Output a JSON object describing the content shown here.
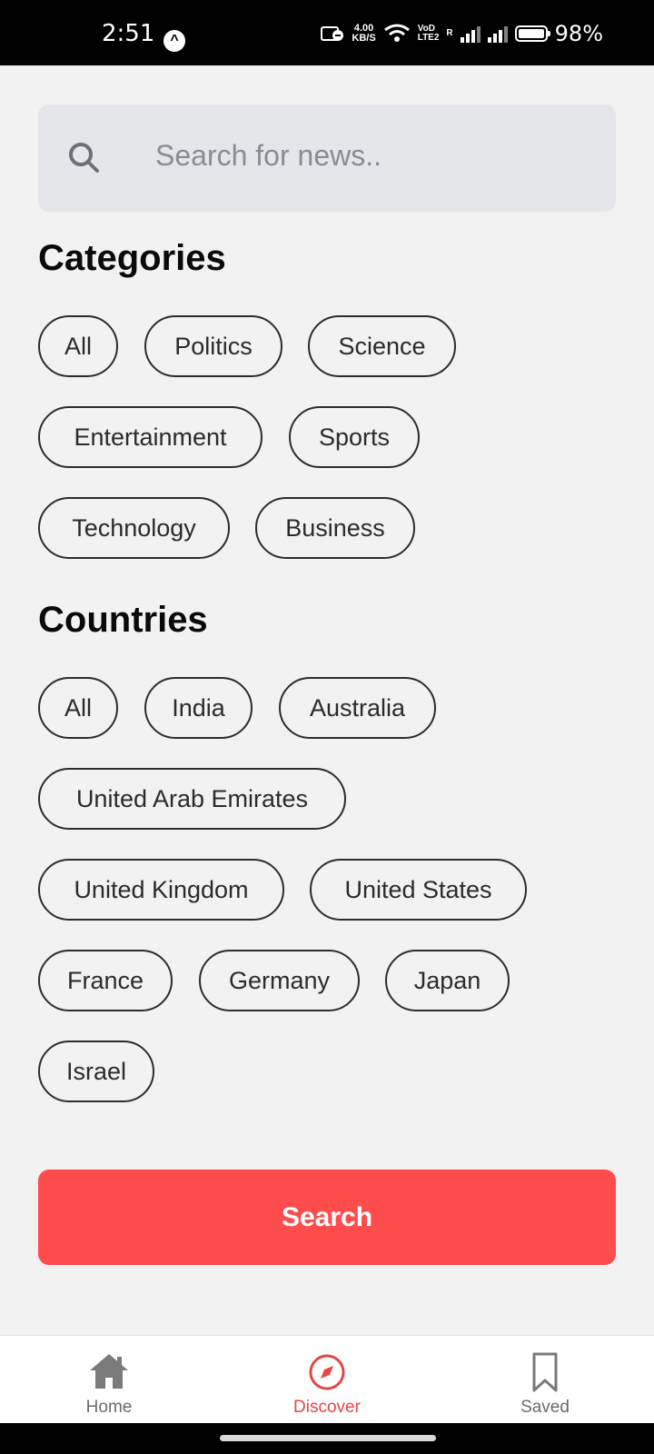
{
  "status_bar": {
    "time": "2:51",
    "speed_value": "4.00",
    "speed_unit": "KB/S",
    "volte_top": "VoD",
    "volte_bottom": "LTE2",
    "roaming": "R",
    "battery": "98%",
    "icons": [
      "app-notification-icon",
      "data-saver-icon",
      "wifi-icon",
      "signal-icon",
      "battery-icon"
    ]
  },
  "search": {
    "placeholder": "Search for news.."
  },
  "categories": {
    "title": "Categories",
    "items": [
      "All",
      "Politics",
      "Science",
      "Entertainment",
      "Sports",
      "Technology",
      "Business"
    ]
  },
  "countries": {
    "title": "Countries",
    "items": [
      "All",
      "India",
      "Australia",
      "United Arab Emirates",
      "United Kingdom",
      "United States",
      "France",
      "Germany",
      "Japan",
      "Israel"
    ]
  },
  "search_button": {
    "label": "Search"
  },
  "bottom_nav": {
    "items": [
      {
        "label": "Home",
        "icon": "home-icon"
      },
      {
        "label": "Discover",
        "icon": "compass-icon"
      },
      {
        "label": "Saved",
        "icon": "bookmark-icon"
      }
    ],
    "active_color": "#e84545"
  },
  "colors": {
    "accent": "#ff4c4c",
    "background": "#f2f2f2",
    "search_bg": "#e5e6ea"
  }
}
